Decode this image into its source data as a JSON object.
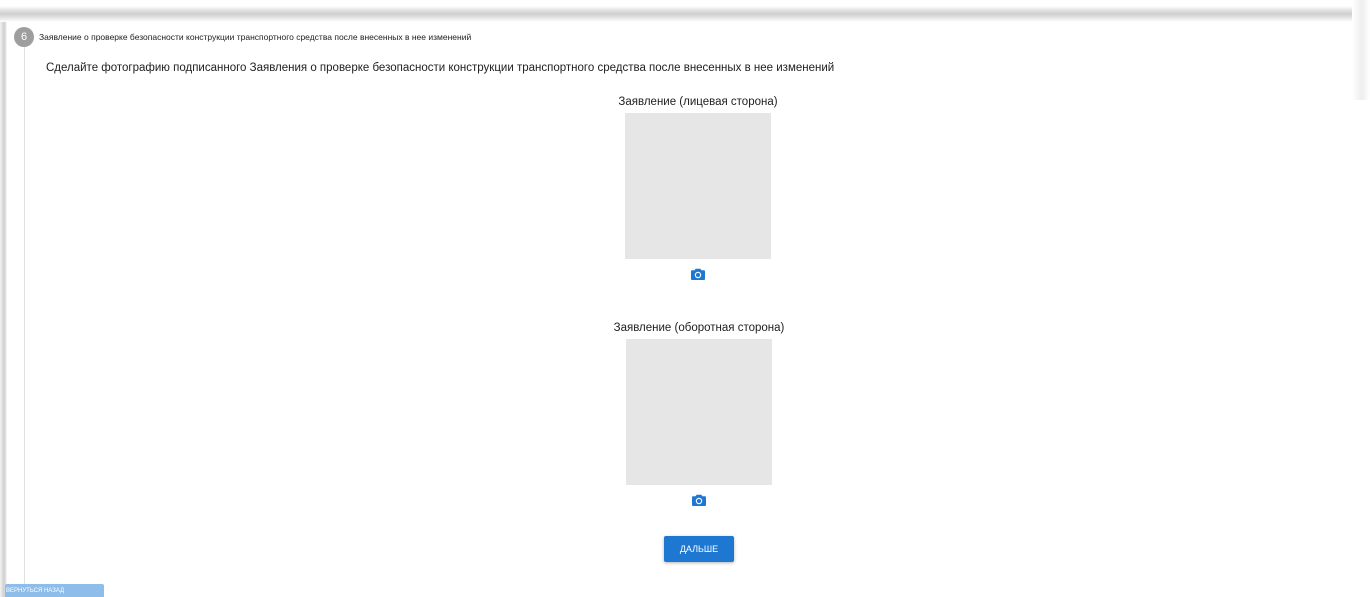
{
  "step": {
    "number": "6",
    "title": "Заявление о проверке безопасности конструкции транспортного средства после внесенных в нее изменений"
  },
  "instruction": "Сделайте фотографию подписанного Заявления о проверке безопасности конструкции транспортного средства после внесенных в нее изменений",
  "documents": [
    {
      "label": "Заявление (лицевая сторона)",
      "icon": "camera-icon"
    },
    {
      "label": "Заявление (оборотная сторона)",
      "icon": "camera-icon"
    }
  ],
  "actions": {
    "next_label": "ДАЛЬШЕ",
    "back_label": "ВЕРНУТЬСЯ НАЗАД"
  },
  "colors": {
    "primary": "#1e78d2",
    "primary_disabled": "#8fbde9",
    "badge": "#9e9e9e",
    "placeholder": "#e6e6e6"
  }
}
